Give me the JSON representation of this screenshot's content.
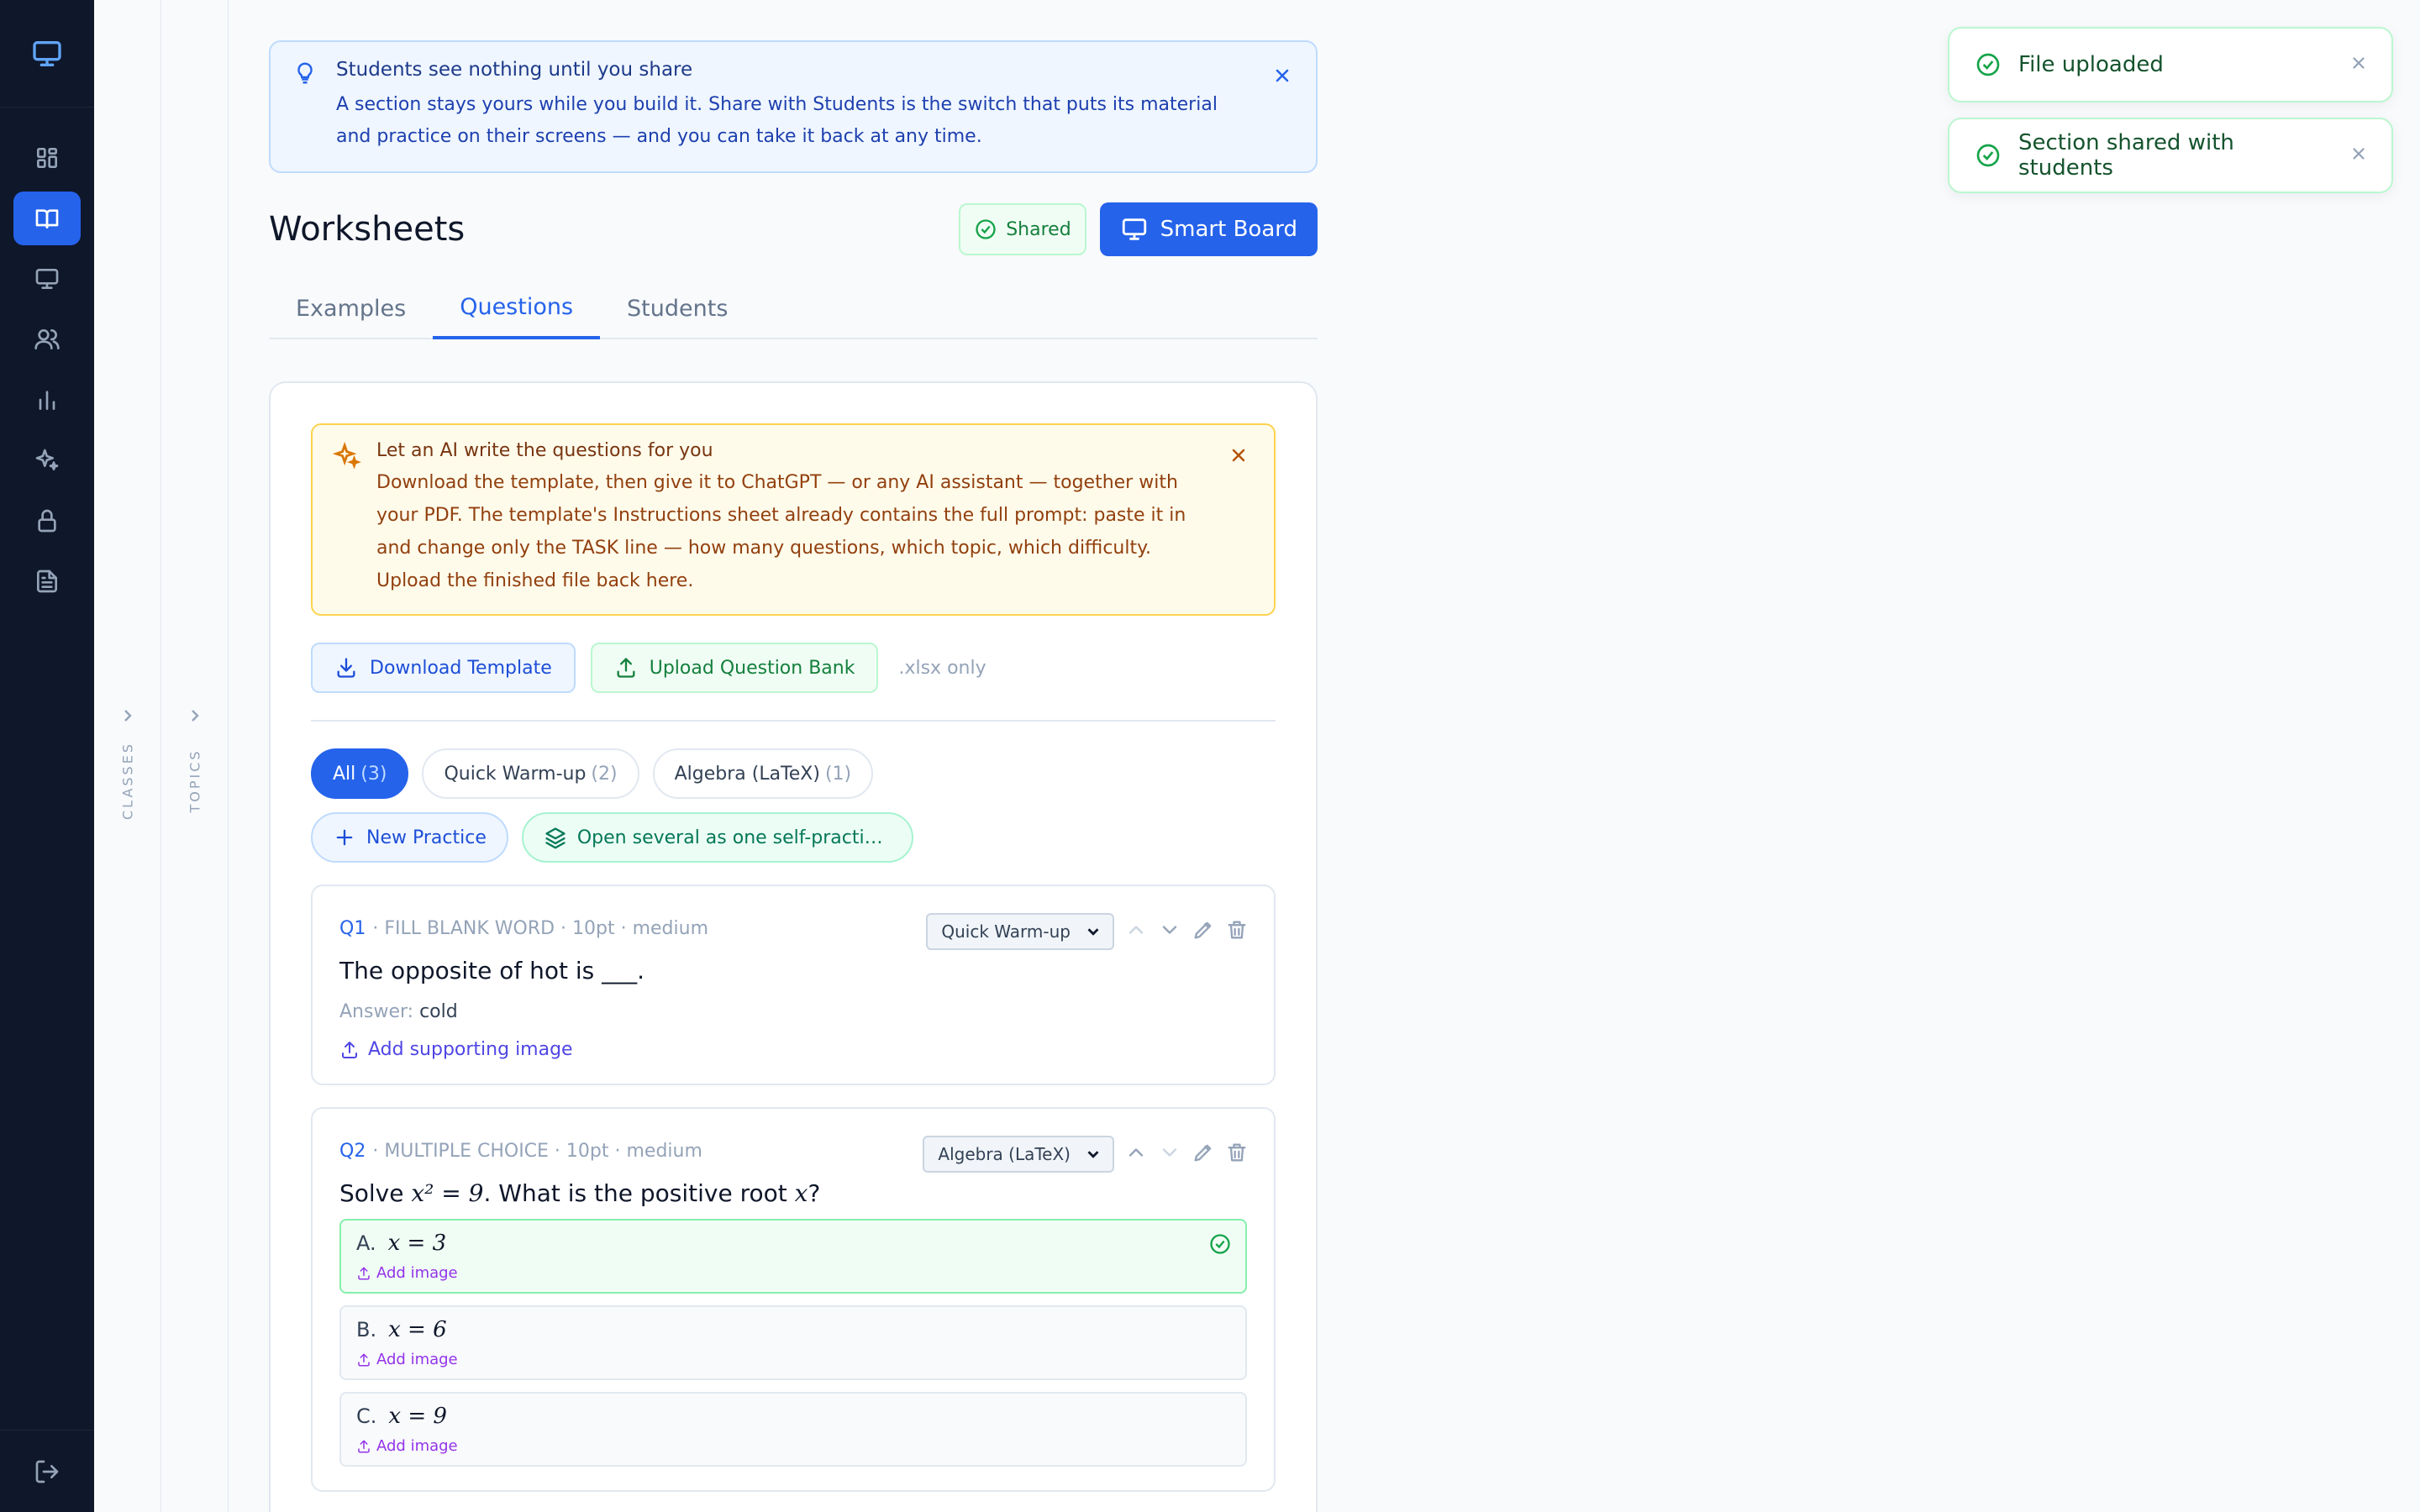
{
  "colors": {
    "sidebar": "#0f172a",
    "accent": "#2563eb",
    "success": "#16a34a",
    "warning": "#d97706"
  },
  "sidebar": {
    "logo_icon": "monitor-icon",
    "items": [
      {
        "icon": "dashboard-icon"
      },
      {
        "icon": "book-icon",
        "active": true
      },
      {
        "icon": "monitor-icon"
      },
      {
        "icon": "users-icon"
      },
      {
        "icon": "bar-chart-icon"
      },
      {
        "icon": "sparkles-icon"
      },
      {
        "icon": "lock-icon"
      },
      {
        "icon": "document-icon"
      }
    ],
    "logout_icon": "logout-icon"
  },
  "rails": {
    "classes_label": "CLASSES",
    "topics_label": "TOPICS"
  },
  "info_banner": {
    "title": "Students see nothing until you share",
    "body": "A section stays yours while you build it. Share with Students is the switch that puts its material and practice on their screens — and you can take it back at any time."
  },
  "header": {
    "title": "Worksheets",
    "shared_label": "Shared",
    "smart_board_label": "Smart Board"
  },
  "tabs": [
    {
      "label": "Examples"
    },
    {
      "label": "Questions",
      "active": true
    },
    {
      "label": "Students"
    }
  ],
  "ai_banner": {
    "title": "Let an AI write the questions for you",
    "body": "Download the template, then give it to ChatGPT — or any AI assistant — together with your PDF. The template's Instructions sheet already contains the full prompt: paste it in and change only the TASK line — how many questions, which topic, which difficulty. Upload the finished file back here."
  },
  "actions": {
    "download_label": "Download Template",
    "upload_label": "Upload Question Bank",
    "hint": ".xlsx only"
  },
  "filters": [
    {
      "label": "All",
      "count": "(3)",
      "active": true
    },
    {
      "label": "Quick Warm-up",
      "count": "(2)"
    },
    {
      "label": "Algebra (LaTeX)",
      "count": "(1)"
    }
  ],
  "practice": {
    "new_label": "New Practice",
    "open_label": "Open several as one self-practice session"
  },
  "questions": [
    {
      "num": "Q1",
      "meta": "· FILL BLANK WORD · 10pt · medium",
      "topic": "Quick Warm-up",
      "text": "The opposite of hot is ___.",
      "answer_label": "Answer:",
      "answer": "cold",
      "image_link": "Add supporting image"
    },
    {
      "num": "Q2",
      "meta": "· MULTIPLE CHOICE · 10pt · medium",
      "topic": "Algebra (LaTeX)",
      "text_pre": "Solve",
      "math_1": "x² = 9",
      "text_mid": ". What is the positive root",
      "math_2": "x",
      "text_post": "?",
      "options": [
        {
          "letter": "A.",
          "math": "x = 3",
          "add": "Add image",
          "correct": true
        },
        {
          "letter": "B.",
          "math": "x = 6",
          "add": "Add image"
        },
        {
          "letter": "C.",
          "math": "x = 9",
          "add": "Add image"
        }
      ]
    }
  ],
  "toasts": [
    {
      "text": "File uploaded"
    },
    {
      "text": "Section shared with students"
    }
  ]
}
